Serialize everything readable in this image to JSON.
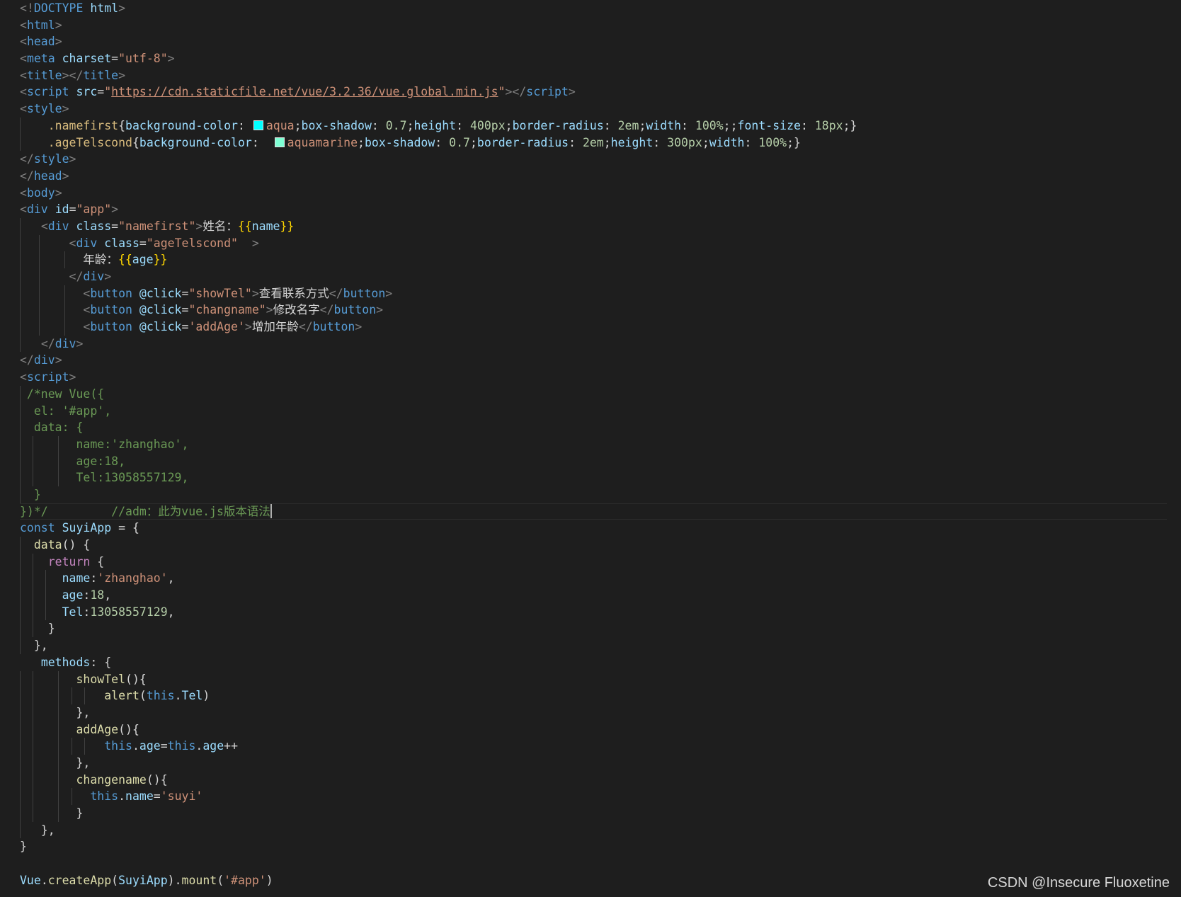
{
  "editor": {
    "theme_colors": {
      "background": "#1e1e1e",
      "tag": "#569cd6",
      "attribute": "#9cdcfe",
      "string": "#ce9178",
      "comment": "#6a9955",
      "function": "#dcdcaa",
      "keyword_control": "#c586c0",
      "number": "#b5cea8",
      "selector": "#d7ba7d",
      "mustache": "#ffd700"
    },
    "lines": [
      [
        {
          "t": "<!",
          "c": "brk"
        },
        {
          "t": "DOCTYPE",
          "c": "tag"
        },
        {
          "t": " ",
          "c": "txt"
        },
        {
          "t": "html",
          "c": "attr"
        },
        {
          "t": ">",
          "c": "brk"
        }
      ],
      [
        {
          "t": "<",
          "c": "brk"
        },
        {
          "t": "html",
          "c": "tag"
        },
        {
          "t": ">",
          "c": "brk"
        }
      ],
      [
        {
          "t": "<",
          "c": "brk"
        },
        {
          "t": "head",
          "c": "tag"
        },
        {
          "t": ">",
          "c": "brk"
        }
      ],
      [
        {
          "t": "<",
          "c": "brk"
        },
        {
          "t": "meta",
          "c": "tag"
        },
        {
          "t": " ",
          "c": "txt"
        },
        {
          "t": "charset",
          "c": "attr"
        },
        {
          "t": "=",
          "c": "txt"
        },
        {
          "t": "\"utf-8\"",
          "c": "str"
        },
        {
          "t": ">",
          "c": "brk"
        }
      ],
      [
        {
          "t": "<",
          "c": "brk"
        },
        {
          "t": "title",
          "c": "tag"
        },
        {
          "t": "></",
          "c": "brk"
        },
        {
          "t": "title",
          "c": "tag"
        },
        {
          "t": ">",
          "c": "brk"
        }
      ],
      [
        {
          "t": "<",
          "c": "brk"
        },
        {
          "t": "script",
          "c": "tag"
        },
        {
          "t": " ",
          "c": "txt"
        },
        {
          "t": "src",
          "c": "attr"
        },
        {
          "t": "=",
          "c": "txt"
        },
        {
          "t": "\"",
          "c": "str"
        },
        {
          "t": "https://cdn.staticfile.net/vue/3.2.36/vue.global.min.js",
          "c": "str-link"
        },
        {
          "t": "\"",
          "c": "str"
        },
        {
          "t": "></",
          "c": "brk"
        },
        {
          "t": "script",
          "c": "tag"
        },
        {
          "t": ">",
          "c": "brk"
        }
      ],
      [
        {
          "t": "<",
          "c": "brk"
        },
        {
          "t": "style",
          "c": "tag"
        },
        {
          "t": ">",
          "c": "brk"
        }
      ],
      [
        {
          "t": "    ",
          "c": "txt"
        },
        {
          "t": ".namefirst",
          "c": "sel"
        },
        {
          "t": "{",
          "c": "txt"
        },
        {
          "t": "background-color",
          "c": "prop"
        },
        {
          "t": ": ",
          "c": "txt"
        },
        {
          "sw": "#00ffff"
        },
        {
          "t": "aqua",
          "c": "str"
        },
        {
          "t": ";",
          "c": "txt"
        },
        {
          "t": "box-shadow",
          "c": "prop"
        },
        {
          "t": ": ",
          "c": "txt"
        },
        {
          "t": "0.7",
          "c": "num"
        },
        {
          "t": ";",
          "c": "txt"
        },
        {
          "t": "height",
          "c": "prop"
        },
        {
          "t": ": ",
          "c": "txt"
        },
        {
          "t": "400px",
          "c": "num"
        },
        {
          "t": ";",
          "c": "txt"
        },
        {
          "t": "border-radius",
          "c": "prop"
        },
        {
          "t": ": ",
          "c": "txt"
        },
        {
          "t": "2em",
          "c": "num"
        },
        {
          "t": ";",
          "c": "txt"
        },
        {
          "t": "width",
          "c": "prop"
        },
        {
          "t": ": ",
          "c": "txt"
        },
        {
          "t": "100%",
          "c": "num"
        },
        {
          "t": ";;",
          "c": "txt"
        },
        {
          "t": "font-size",
          "c": "prop"
        },
        {
          "t": ": ",
          "c": "txt"
        },
        {
          "t": "18px",
          "c": "num"
        },
        {
          "t": ";}",
          "c": "txt"
        }
      ],
      [
        {
          "t": "    ",
          "c": "txt"
        },
        {
          "t": ".ageTelscond",
          "c": "sel"
        },
        {
          "t": "{",
          "c": "txt"
        },
        {
          "t": "background-color",
          "c": "prop"
        },
        {
          "t": ":  ",
          "c": "txt"
        },
        {
          "sw": "#7fffd4"
        },
        {
          "t": "aquamarine",
          "c": "str"
        },
        {
          "t": ";",
          "c": "txt"
        },
        {
          "t": "box-shadow",
          "c": "prop"
        },
        {
          "t": ": ",
          "c": "txt"
        },
        {
          "t": "0.7",
          "c": "num"
        },
        {
          "t": ";",
          "c": "txt"
        },
        {
          "t": "border-radius",
          "c": "prop"
        },
        {
          "t": ": ",
          "c": "txt"
        },
        {
          "t": "2em",
          "c": "num"
        },
        {
          "t": ";",
          "c": "txt"
        },
        {
          "t": "height",
          "c": "prop"
        },
        {
          "t": ": ",
          "c": "txt"
        },
        {
          "t": "300px",
          "c": "num"
        },
        {
          "t": ";",
          "c": "txt"
        },
        {
          "t": "width",
          "c": "prop"
        },
        {
          "t": ": ",
          "c": "txt"
        },
        {
          "t": "100%",
          "c": "num"
        },
        {
          "t": ";}",
          "c": "txt"
        }
      ],
      [
        {
          "t": "</",
          "c": "brk"
        },
        {
          "t": "style",
          "c": "tag"
        },
        {
          "t": ">",
          "c": "brk"
        }
      ],
      [
        {
          "t": "</",
          "c": "brk"
        },
        {
          "t": "head",
          "c": "tag"
        },
        {
          "t": ">",
          "c": "brk"
        }
      ],
      [
        {
          "t": "<",
          "c": "brk"
        },
        {
          "t": "body",
          "c": "tag"
        },
        {
          "t": ">",
          "c": "brk"
        }
      ],
      [
        {
          "t": "<",
          "c": "brk"
        },
        {
          "t": "div",
          "c": "tag"
        },
        {
          "t": " ",
          "c": "txt"
        },
        {
          "t": "id",
          "c": "attr"
        },
        {
          "t": "=",
          "c": "txt"
        },
        {
          "t": "\"app\"",
          "c": "str"
        },
        {
          "t": ">",
          "c": "brk"
        }
      ],
      [
        {
          "t": "   ",
          "c": "txt"
        },
        {
          "t": "<",
          "c": "brk"
        },
        {
          "t": "div",
          "c": "tag"
        },
        {
          "t": " ",
          "c": "txt"
        },
        {
          "t": "class",
          "c": "attr"
        },
        {
          "t": "=",
          "c": "txt"
        },
        {
          "t": "\"namefirst\"",
          "c": "str"
        },
        {
          "t": ">",
          "c": "brk"
        },
        {
          "t": "姓名：",
          "c": "txt"
        },
        {
          "t": "{{",
          "c": "mus"
        },
        {
          "t": "name",
          "c": "var"
        },
        {
          "t": "}}",
          "c": "mus"
        }
      ],
      [
        {
          "t": "       ",
          "c": "txt"
        },
        {
          "t": "<",
          "c": "brk"
        },
        {
          "t": "div",
          "c": "tag"
        },
        {
          "t": " ",
          "c": "txt"
        },
        {
          "t": "class",
          "c": "attr"
        },
        {
          "t": "=",
          "c": "txt"
        },
        {
          "t": "\"ageTelscond\"",
          "c": "str"
        },
        {
          "t": "  >",
          "c": "brk"
        }
      ],
      [
        {
          "t": "         ",
          "c": "txt"
        },
        {
          "t": "年龄：",
          "c": "txt"
        },
        {
          "t": "{{",
          "c": "mus"
        },
        {
          "t": "age",
          "c": "var"
        },
        {
          "t": "}}",
          "c": "mus"
        }
      ],
      [
        {
          "t": "       ",
          "c": "txt"
        },
        {
          "t": "</",
          "c": "brk"
        },
        {
          "t": "div",
          "c": "tag"
        },
        {
          "t": ">",
          "c": "brk"
        }
      ],
      [
        {
          "t": "         ",
          "c": "txt"
        },
        {
          "t": "<",
          "c": "brk"
        },
        {
          "t": "button",
          "c": "tag"
        },
        {
          "t": " ",
          "c": "txt"
        },
        {
          "t": "@click",
          "c": "attr"
        },
        {
          "t": "=",
          "c": "txt"
        },
        {
          "t": "\"showTel\"",
          "c": "str"
        },
        {
          "t": ">",
          "c": "brk"
        },
        {
          "t": "查看联系方式",
          "c": "txt"
        },
        {
          "t": "</",
          "c": "brk"
        },
        {
          "t": "button",
          "c": "tag"
        },
        {
          "t": ">",
          "c": "brk"
        }
      ],
      [
        {
          "t": "         ",
          "c": "txt"
        },
        {
          "t": "<",
          "c": "brk"
        },
        {
          "t": "button",
          "c": "tag"
        },
        {
          "t": " ",
          "c": "txt"
        },
        {
          "t": "@click",
          "c": "attr"
        },
        {
          "t": "=",
          "c": "txt"
        },
        {
          "t": "\"changname\"",
          "c": "str"
        },
        {
          "t": ">",
          "c": "brk"
        },
        {
          "t": "修改名字",
          "c": "txt"
        },
        {
          "t": "</",
          "c": "brk"
        },
        {
          "t": "button",
          "c": "tag"
        },
        {
          "t": ">",
          "c": "brk"
        }
      ],
      [
        {
          "t": "         ",
          "c": "txt"
        },
        {
          "t": "<",
          "c": "brk"
        },
        {
          "t": "button",
          "c": "tag"
        },
        {
          "t": " ",
          "c": "txt"
        },
        {
          "t": "@click",
          "c": "attr"
        },
        {
          "t": "=",
          "c": "txt"
        },
        {
          "t": "'addAge'",
          "c": "str"
        },
        {
          "t": ">",
          "c": "brk"
        },
        {
          "t": "增加年龄",
          "c": "txt"
        },
        {
          "t": "</",
          "c": "brk"
        },
        {
          "t": "button",
          "c": "tag"
        },
        {
          "t": ">",
          "c": "brk"
        }
      ],
      [
        {
          "t": "   ",
          "c": "txt"
        },
        {
          "t": "</",
          "c": "brk"
        },
        {
          "t": "div",
          "c": "tag"
        },
        {
          "t": ">",
          "c": "brk"
        }
      ],
      [
        {
          "t": "</",
          "c": "brk"
        },
        {
          "t": "div",
          "c": "tag"
        },
        {
          "t": ">",
          "c": "brk"
        }
      ],
      [
        {
          "t": "<",
          "c": "brk"
        },
        {
          "t": "script",
          "c": "tag"
        },
        {
          "t": ">",
          "c": "brk"
        }
      ],
      [
        {
          "t": " /*new Vue({",
          "c": "cmt"
        }
      ],
      [
        {
          "t": "  el: '#app',",
          "c": "cmt"
        }
      ],
      [
        {
          "t": "  data: {",
          "c": "cmt"
        }
      ],
      [
        {
          "t": "        name:'zhanghao',",
          "c": "cmt"
        }
      ],
      [
        {
          "t": "        age:18,",
          "c": "cmt"
        }
      ],
      [
        {
          "t": "        Tel:13058557129,",
          "c": "cmt"
        }
      ],
      [
        {
          "t": "  }",
          "c": "cmt"
        }
      ],
      [
        {
          "t": "})*/         //adm：此为vue.js版本语法",
          "c": "cmt"
        }
      ],
      [
        {
          "t": "const",
          "c": "kw"
        },
        {
          "t": " ",
          "c": "txt"
        },
        {
          "t": "SuyiApp",
          "c": "var"
        },
        {
          "t": " = {",
          "c": "txt"
        }
      ],
      [
        {
          "t": "  ",
          "c": "txt"
        },
        {
          "t": "data",
          "c": "fn"
        },
        {
          "t": "() {",
          "c": "txt"
        }
      ],
      [
        {
          "t": "    ",
          "c": "txt"
        },
        {
          "t": "return",
          "c": "ctl"
        },
        {
          "t": " {",
          "c": "txt"
        }
      ],
      [
        {
          "t": "      ",
          "c": "txt"
        },
        {
          "t": "name",
          "c": "var"
        },
        {
          "t": ":",
          "c": "txt"
        },
        {
          "t": "'zhanghao'",
          "c": "str"
        },
        {
          "t": ",",
          "c": "txt"
        }
      ],
      [
        {
          "t": "      ",
          "c": "txt"
        },
        {
          "t": "age",
          "c": "var"
        },
        {
          "t": ":",
          "c": "txt"
        },
        {
          "t": "18",
          "c": "num"
        },
        {
          "t": ",",
          "c": "txt"
        }
      ],
      [
        {
          "t": "      ",
          "c": "txt"
        },
        {
          "t": "Tel",
          "c": "var"
        },
        {
          "t": ":",
          "c": "txt"
        },
        {
          "t": "13058557129",
          "c": "num"
        },
        {
          "t": ",",
          "c": "txt"
        }
      ],
      [
        {
          "t": "    }",
          "c": "txt"
        }
      ],
      [
        {
          "t": "  },",
          "c": "txt"
        }
      ],
      [
        {
          "t": "   ",
          "c": "txt"
        },
        {
          "t": "methods",
          "c": "var"
        },
        {
          "t": ": {",
          "c": "txt"
        }
      ],
      [
        {
          "t": "        ",
          "c": "txt"
        },
        {
          "t": "showTel",
          "c": "fn"
        },
        {
          "t": "(){",
          "c": "txt"
        }
      ],
      [
        {
          "t": "            ",
          "c": "txt"
        },
        {
          "t": "alert",
          "c": "fn"
        },
        {
          "t": "(",
          "c": "txt"
        },
        {
          "t": "this",
          "c": "kw"
        },
        {
          "t": ".",
          "c": "txt"
        },
        {
          "t": "Tel",
          "c": "var"
        },
        {
          "t": ")",
          "c": "txt"
        }
      ],
      [
        {
          "t": "        },",
          "c": "txt"
        }
      ],
      [
        {
          "t": "        ",
          "c": "txt"
        },
        {
          "t": "addAge",
          "c": "fn"
        },
        {
          "t": "(){",
          "c": "txt"
        }
      ],
      [
        {
          "t": "            ",
          "c": "txt"
        },
        {
          "t": "this",
          "c": "kw"
        },
        {
          "t": ".",
          "c": "txt"
        },
        {
          "t": "age",
          "c": "var"
        },
        {
          "t": "=",
          "c": "txt"
        },
        {
          "t": "this",
          "c": "kw"
        },
        {
          "t": ".",
          "c": "txt"
        },
        {
          "t": "age",
          "c": "var"
        },
        {
          "t": "++",
          "c": "txt"
        }
      ],
      [
        {
          "t": "        },",
          "c": "txt"
        }
      ],
      [
        {
          "t": "        ",
          "c": "txt"
        },
        {
          "t": "changename",
          "c": "fn"
        },
        {
          "t": "(){",
          "c": "txt"
        }
      ],
      [
        {
          "t": "          ",
          "c": "txt"
        },
        {
          "t": "this",
          "c": "kw"
        },
        {
          "t": ".",
          "c": "txt"
        },
        {
          "t": "name",
          "c": "var"
        },
        {
          "t": "=",
          "c": "txt"
        },
        {
          "t": "'suyi'",
          "c": "str"
        }
      ],
      [
        {
          "t": "        }",
          "c": "txt"
        }
      ],
      [
        {
          "t": "   },",
          "c": "txt"
        }
      ],
      [
        {
          "t": "}",
          "c": "txt"
        }
      ],
      [],
      [
        {
          "t": "Vue",
          "c": "var"
        },
        {
          "t": ".",
          "c": "txt"
        },
        {
          "t": "createApp",
          "c": "fn"
        },
        {
          "t": "(",
          "c": "txt"
        },
        {
          "t": "SuyiApp",
          "c": "var"
        },
        {
          "t": ").",
          "c": "txt"
        },
        {
          "t": "mount",
          "c": "fn"
        },
        {
          "t": "(",
          "c": "txt"
        },
        {
          "t": "'#app'",
          "c": "str"
        },
        {
          "t": ")",
          "c": "txt"
        }
      ]
    ]
  },
  "watermark": {
    "text": "CSDN @Insecure Fluoxetine"
  }
}
